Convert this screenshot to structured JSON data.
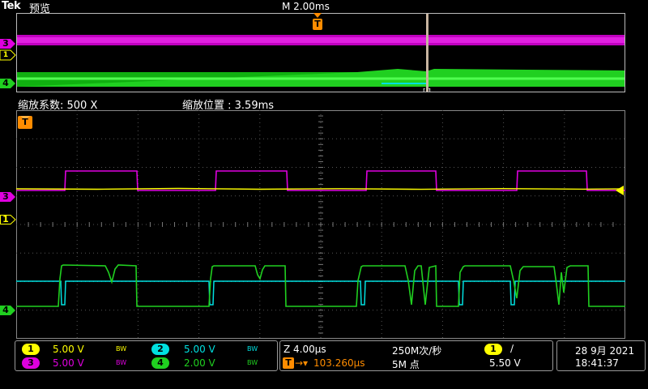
{
  "header": {
    "brand": "Tek",
    "mode": "预览",
    "timebase": "M 2.00ms"
  },
  "zoom": {
    "factor_label": "缩放系数: 500 X",
    "position_label": "缩放位置 : 3.59ms"
  },
  "markers": {
    "trigger": "T",
    "ch3": "3",
    "ch1": "1",
    "ch4": "4"
  },
  "channels": [
    {
      "id": "1",
      "scale": "5.00 V",
      "color": "#ffff00",
      "bw": "BW"
    },
    {
      "id": "3",
      "scale": "5.00 V",
      "color": "#e000e0",
      "bw": "BW"
    },
    {
      "id": "2",
      "scale": "5.00 V",
      "color": "#00e0e0",
      "bw": "BW"
    },
    {
      "id": "4",
      "scale": "2.00 V",
      "color": "#20d020",
      "bw": "BW"
    }
  ],
  "horizontal": {
    "zoom_scale": "Z 4.00µs",
    "trigger_icon": "T",
    "trigger_pos": "103.260µs",
    "sample_rate": "250M次/秒",
    "record_length": "5M 点"
  },
  "trigger_info": {
    "source": "1",
    "slope": "∕",
    "level": "5.50 V"
  },
  "datetime": {
    "date": "28 9月 2021",
    "time": "18:41:37"
  },
  "colors": {
    "ch1": "#ffff00",
    "ch2": "#00e0e0",
    "ch3": "#e000e0",
    "ch4": "#20d020",
    "trigger": "#ff8c00",
    "grid": "#555555"
  }
}
